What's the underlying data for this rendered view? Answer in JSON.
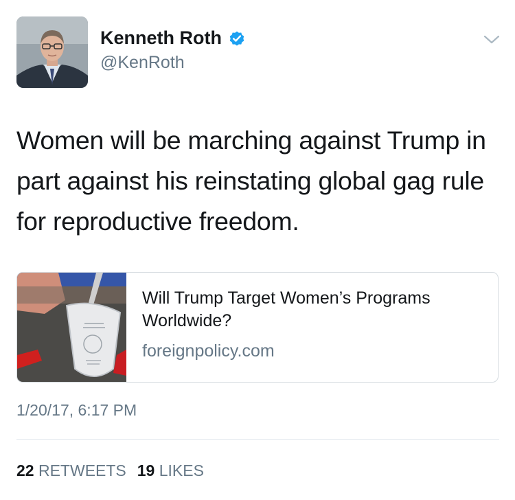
{
  "author": {
    "name": "Kenneth Roth",
    "handle": "@KenRoth",
    "verified": true,
    "avatar_icon": "profile-photo"
  },
  "tweet": {
    "text": "Women will be marching against Trump in part against his reinstating global gag rule for reproductive freedom."
  },
  "link_card": {
    "title": "Will Trump Target Women’s Programs Worldwide?",
    "domain": "foreignpolicy.com",
    "image_icon": "ceremonial-shovel-photo"
  },
  "timestamp": "1/20/17, 6:17 PM",
  "stats": {
    "retweets_count": "22",
    "retweets_label": "RETWEETS",
    "likes_count": "19",
    "likes_label": "LIKES"
  },
  "colors": {
    "text": "#14171a",
    "secondary": "#657786",
    "verified_blue": "#1da1f2",
    "border": "#d5dbe0"
  }
}
